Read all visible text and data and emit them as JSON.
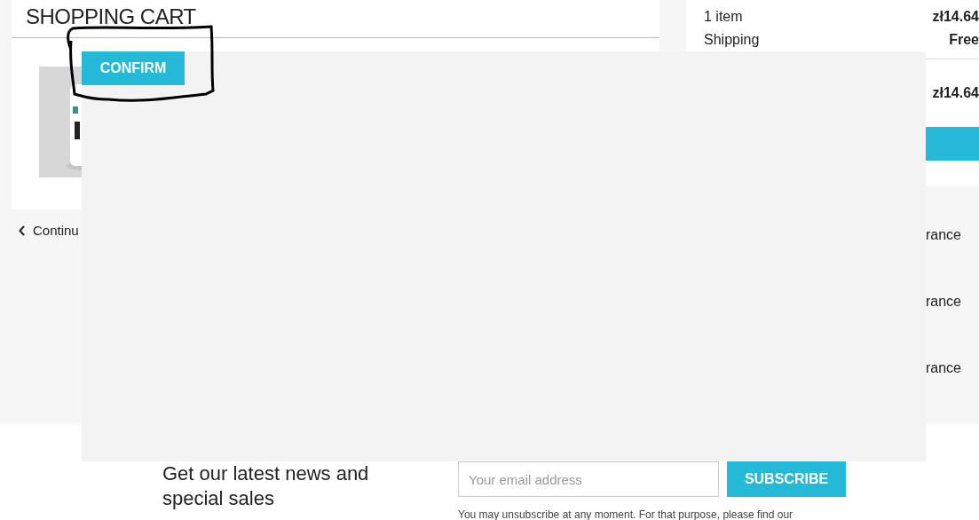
{
  "cart": {
    "title": "SHOPPING CART",
    "continue_link": "Continu"
  },
  "summary": {
    "rows": [
      {
        "label": "1 item",
        "value": "zł14.64"
      },
      {
        "label": "Shipping",
        "value": "Free"
      }
    ],
    "total_value": "zł14.64"
  },
  "reassurance": [
    "rance",
    "rance",
    "rance"
  ],
  "overlay": {
    "button": "CONFIRM"
  },
  "newsletter": {
    "heading": "Get our latest news and special sales",
    "placeholder": "Your email address",
    "button": "SUBSCRIBE",
    "note": "You may unsubscribe at any moment. For that purpose, please find our"
  }
}
